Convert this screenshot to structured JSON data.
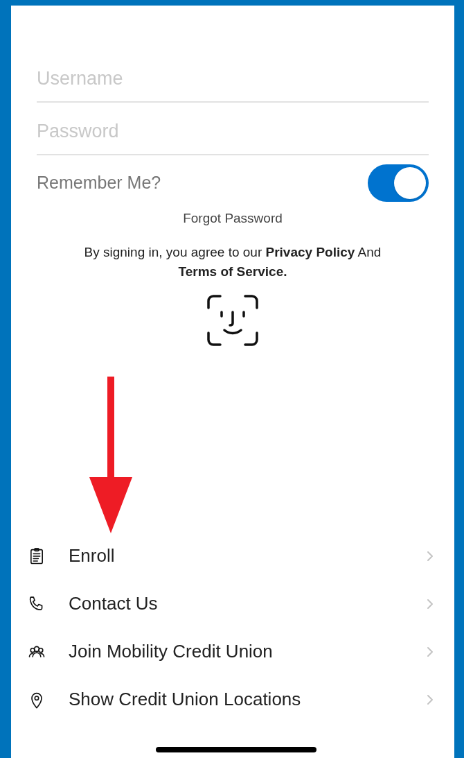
{
  "login": {
    "fields": [
      {
        "placeholder": "Username"
      },
      {
        "placeholder": "Password"
      }
    ],
    "remember": {
      "label": "Remember Me?",
      "on": true
    },
    "forgot": "Forgot Password",
    "agreement": "By signing in, you agree to our **Privacy Policy** And **Terms of Service.**"
  },
  "menu": [
    {
      "label": "Enroll",
      "kind": "clipboard"
    },
    {
      "label": "Contact Us",
      "kind": "phone"
    },
    {
      "label": "Join Mobility Credit Union",
      "kind": "members"
    },
    {
      "label": "Show Credit Union Locations",
      "kind": "pin"
    }
  ]
}
